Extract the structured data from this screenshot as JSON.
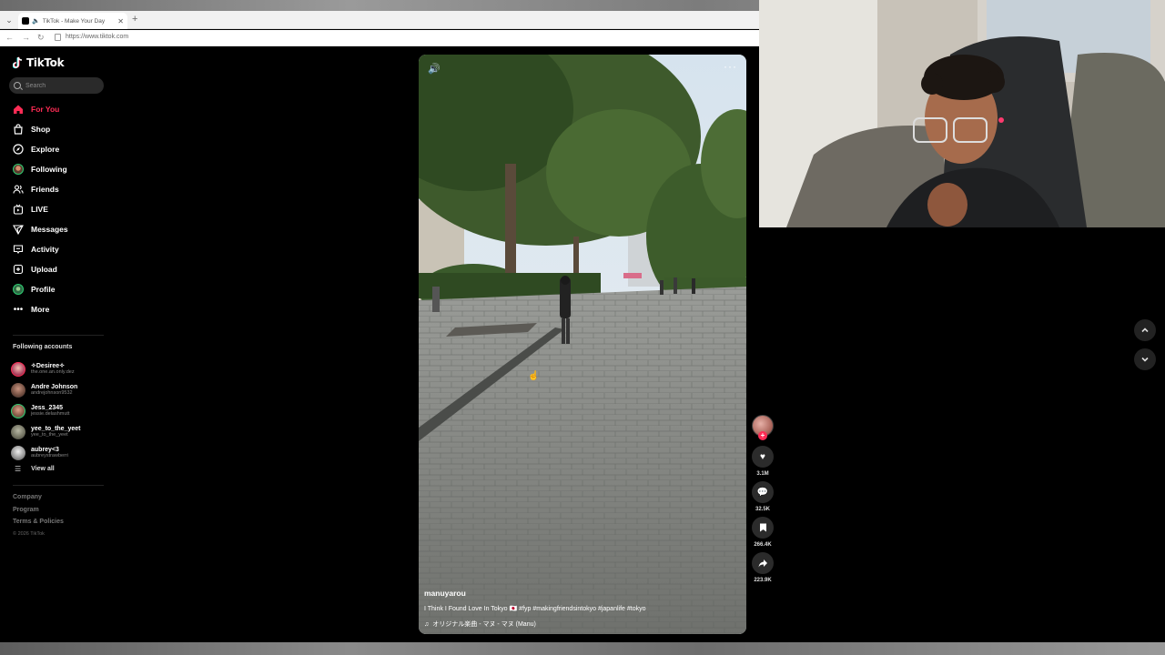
{
  "browser": {
    "tab_title": "TikTok - Make Your Day",
    "url": "https://www.tiktok.com"
  },
  "tiktok": {
    "logo_text": "TikTok",
    "search_placeholder": "Search",
    "nav": [
      {
        "label": "For You",
        "icon": "home-icon",
        "active": true
      },
      {
        "label": "Shop",
        "icon": "shopping-bag-icon"
      },
      {
        "label": "Explore",
        "icon": "compass-icon"
      },
      {
        "label": "Following",
        "icon": "avatar"
      },
      {
        "label": "Friends",
        "icon": "friends-icon"
      },
      {
        "label": "LIVE",
        "icon": "live-icon"
      },
      {
        "label": "Messages",
        "icon": "paper-plane-icon"
      },
      {
        "label": "Activity",
        "icon": "inbox-icon"
      },
      {
        "label": "Upload",
        "icon": "plus-square-icon"
      },
      {
        "label": "Profile",
        "icon": "avatar"
      },
      {
        "label": "More",
        "icon": "ellipsis-icon"
      }
    ],
    "following_accounts": {
      "title": "Following accounts",
      "accounts": [
        {
          "name": "✧Desiree✧",
          "handle": "the.one.an.only.dez"
        },
        {
          "name": "Andre Johnson",
          "handle": "andrejohnson9532"
        },
        {
          "name": "Jess_2345",
          "handle": "jessie.delashmutt"
        },
        {
          "name": "yee_to_the_yeet",
          "handle": "yee_to_the_yeet"
        },
        {
          "name": "aubrey<3",
          "handle": "aubreystrawberri"
        }
      ],
      "view_all": "View all"
    },
    "footer": {
      "links": [
        "Company",
        "Program",
        "Terms & Policies"
      ],
      "copyright": "© 2026 TikTok"
    },
    "video": {
      "username": "manuyarou",
      "caption": "I Think I Found Love In Tokyo 🇯🇵 #fyp #makingfriendsintokyo #japanlife #tokyo",
      "music": "オリジナル楽曲 - マヌ - マヌ (Manu)"
    },
    "actions": {
      "likes": "3.1M",
      "comments": "32.5K",
      "saves": "266.4K",
      "shares": "223.9K"
    }
  },
  "colors": {
    "accent": "#fe2c55",
    "background": "#000000"
  }
}
